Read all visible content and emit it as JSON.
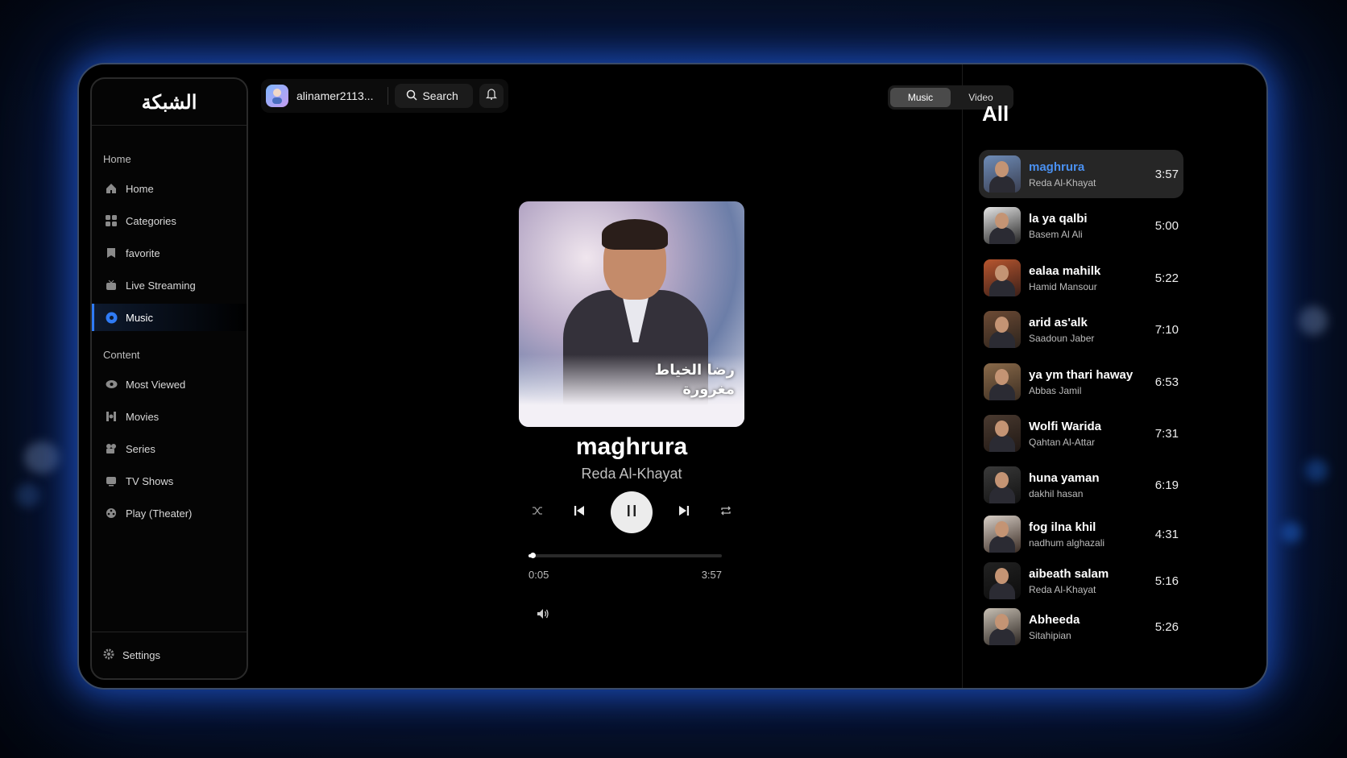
{
  "app": {
    "logo_text": "الشبكة"
  },
  "sidebar": {
    "section_home": "Home",
    "home_items": [
      {
        "label": "Home",
        "icon": "home-icon"
      },
      {
        "label": "Categories",
        "icon": "grid-icon"
      },
      {
        "label": "favorite",
        "icon": "bookmark-icon"
      },
      {
        "label": "Live Streaming",
        "icon": "tv-icon"
      },
      {
        "label": "Music",
        "icon": "music-disc-icon",
        "active": true
      }
    ],
    "section_content": "Content",
    "content_items": [
      {
        "label": "Most Viewed",
        "icon": "eye-icon"
      },
      {
        "label": "Movies",
        "icon": "film-icon"
      },
      {
        "label": "Series",
        "icon": "camera-icon"
      },
      {
        "label": "TV Shows",
        "icon": "tv-icon"
      },
      {
        "label": "Play (Theater)",
        "icon": "reel-icon"
      }
    ],
    "settings_label": "Settings"
  },
  "topbar": {
    "username": "alinamer2113...",
    "search_label": "Search",
    "toggle": [
      "Music",
      "Video"
    ],
    "toggle_selected": "Music"
  },
  "player": {
    "cover_text_line1": "رضا الخياط",
    "cover_text_line2": "مغرورة",
    "title": "maghrura",
    "artist": "Reda Al-Khayat",
    "current_time": "0:05",
    "total_time": "3:57",
    "progress_fraction": 0.021,
    "state": "playing"
  },
  "playlist": {
    "title": "All",
    "items": [
      {
        "name": "maghrura",
        "artist": "Reda Al-Khayat",
        "duration": "3:57",
        "current": true
      },
      {
        "name": "la ya qalbi",
        "artist": "Basem Al Ali",
        "duration": "5:00"
      },
      {
        "name": "ealaa mahilk",
        "artist": "Hamid Mansour",
        "duration": "5:22"
      },
      {
        "name": "arid as'alk",
        "artist": "Saadoun Jaber",
        "duration": "7:10"
      },
      {
        "name": "ya ym thari haway",
        "artist": "Abbas Jamil",
        "duration": "6:53"
      },
      {
        "name": "Wolfi Warida",
        "artist": "Qahtan Al-Attar",
        "duration": "7:31"
      },
      {
        "name": "huna yaman",
        "artist": "dakhil hasan",
        "duration": "6:19"
      },
      {
        "name": "fog ilna khil",
        "artist": "nadhum alghazali",
        "duration": "4:31"
      },
      {
        "name": "aibeath salam",
        "artist": "Reda Al-Khayat",
        "duration": "5:16"
      },
      {
        "name": "Abheeda",
        "artist": "Sitahipian",
        "duration": "5:26"
      }
    ]
  },
  "colors": {
    "accent": "#2f7bf5",
    "current_track": "#4a90f0",
    "glow": "#286eff"
  }
}
